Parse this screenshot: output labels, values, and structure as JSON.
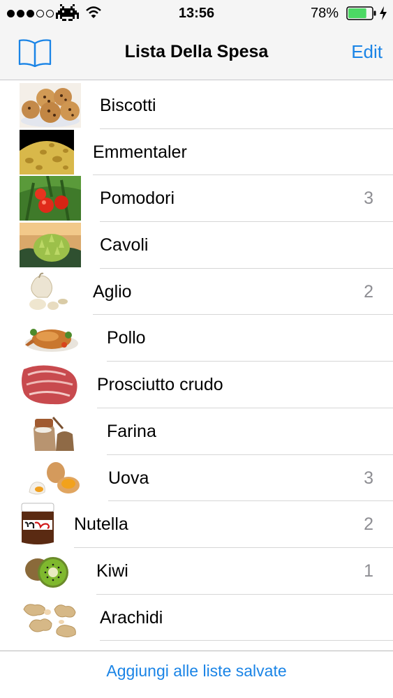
{
  "status_bar": {
    "time": "13:56",
    "battery_percent": "78%",
    "battery_level": 0.78,
    "signal_bars_filled": 3,
    "signal_bars_total": 5
  },
  "nav": {
    "title": "Lista Della Spesa",
    "edit_label": "Edit",
    "left_icon": "book-icon"
  },
  "items": [
    {
      "name": "Biscotti",
      "count": "",
      "icon": "biscotti-thumbnail"
    },
    {
      "name": "Emmentaler",
      "count": "",
      "icon": "emmentaler-thumbnail"
    },
    {
      "name": "Pomodori",
      "count": "3",
      "icon": "pomodori-thumbnail"
    },
    {
      "name": "Cavoli",
      "count": "",
      "icon": "cavoli-thumbnail"
    },
    {
      "name": "Aglio",
      "count": "2",
      "icon": "aglio-thumbnail"
    },
    {
      "name": "Pollo",
      "count": "",
      "icon": "pollo-thumbnail"
    },
    {
      "name": "Prosciutto crudo",
      "count": "",
      "icon": "prosciutto-thumbnail"
    },
    {
      "name": "Farina",
      "count": "",
      "icon": "farina-thumbnail"
    },
    {
      "name": "Uova",
      "count": "3",
      "icon": "uova-thumbnail"
    },
    {
      "name": "Nutella",
      "count": "2",
      "icon": "nutella-thumbnail"
    },
    {
      "name": "Kiwi",
      "count": "1",
      "icon": "kiwi-thumbnail"
    },
    {
      "name": "Arachidi",
      "count": "",
      "icon": "arachidi-thumbnail"
    }
  ],
  "footer": {
    "button_label": "Aggiungi alle liste salvate"
  },
  "colors": {
    "accent": "#1a84e6",
    "battery_green": "#4cd964",
    "count_gray": "#8e8e93"
  }
}
